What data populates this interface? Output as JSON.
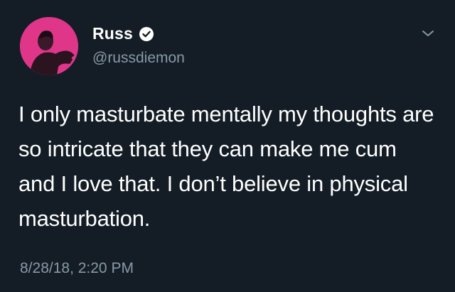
{
  "user": {
    "display_name": "Russ",
    "handle": "@russdiemon",
    "verified": true,
    "avatar_bg": "#e0368a"
  },
  "tweet": {
    "text": "I only masturbate mentally my thoughts are so intricate that they can make me cum and I love that. I don’t believe in physical masturbation.",
    "timestamp": "8/28/18, 2:20 PM"
  },
  "icons": {
    "verified": "verified-badge-icon",
    "menu": "chevron-down-icon"
  },
  "colors": {
    "background": "#141d26",
    "text": "#ffffff",
    "secondary_text": "#8899a6",
    "verified": "#ffffff"
  }
}
